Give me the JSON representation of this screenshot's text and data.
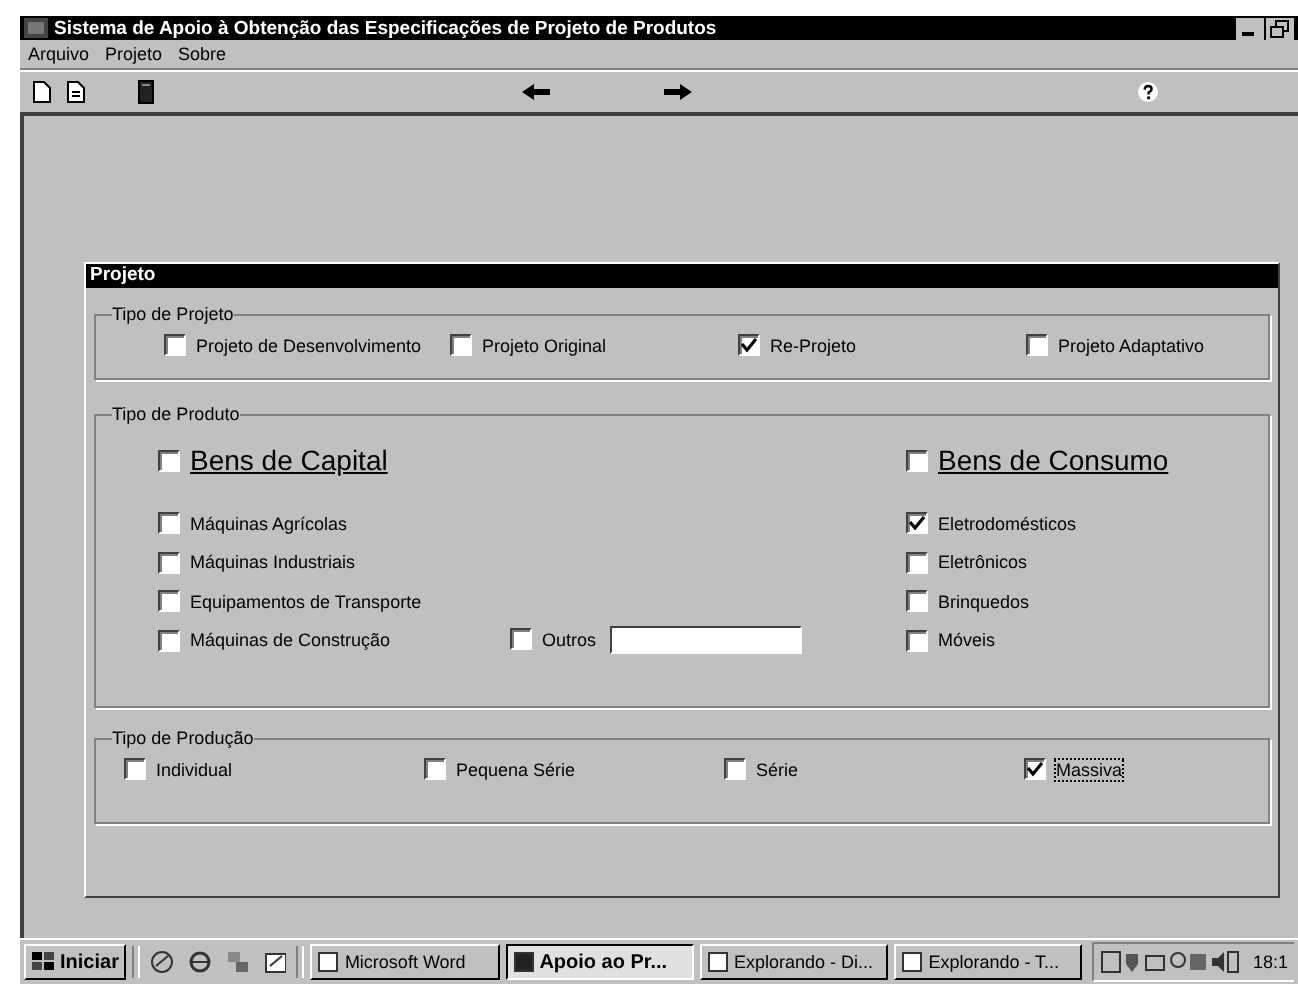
{
  "window": {
    "title": "Sistema de Apoio à Obtenção das Especificações de Projeto de Produtos"
  },
  "menu": [
    {
      "label": "Arquivo"
    },
    {
      "label": "Projeto"
    },
    {
      "label": "Sobre"
    }
  ],
  "dialog": {
    "title": "Projeto",
    "tipo_projeto": {
      "legend": "Tipo de Projeto",
      "options": [
        {
          "label": "Projeto de Desenvolvimento",
          "checked": false
        },
        {
          "label": "Projeto Original",
          "checked": false
        },
        {
          "label": "Re-Projeto",
          "checked": true
        },
        {
          "label": "Projeto Adaptativo",
          "checked": false
        }
      ]
    },
    "tipo_produto": {
      "legend": "Tipo de Produto",
      "capital": {
        "label": "Bens de Capital",
        "checked": false,
        "items": [
          {
            "label": "Máquinas Agrícolas",
            "checked": false
          },
          {
            "label": "Máquinas Industriais",
            "checked": false
          },
          {
            "label": "Equipamentos de Transporte",
            "checked": false
          },
          {
            "label": "Máquinas de Construção",
            "checked": false
          }
        ]
      },
      "outros": {
        "label": "Outros",
        "checked": false
      },
      "consumo": {
        "label": "Bens de Consumo",
        "checked": false,
        "items": [
          {
            "label": "Eletrodomésticos",
            "checked": true
          },
          {
            "label": "Eletrônicos",
            "checked": false
          },
          {
            "label": "Brinquedos",
            "checked": false
          },
          {
            "label": "Móveis",
            "checked": false
          }
        ]
      }
    },
    "tipo_producao": {
      "legend": "Tipo de Produção",
      "options": [
        {
          "label": "Individual",
          "checked": false,
          "focused": false
        },
        {
          "label": "Pequena Série",
          "checked": false,
          "focused": false
        },
        {
          "label": "Série",
          "checked": false,
          "focused": false
        },
        {
          "label": "Massiva",
          "checked": true,
          "focused": true
        }
      ]
    }
  },
  "taskbar": {
    "start": "Iniciar",
    "tasks": [
      {
        "label": "Microsoft Word",
        "selected": false
      },
      {
        "label": "Apoio ao Pr...",
        "selected": true
      },
      {
        "label": "Explorando - Di...",
        "selected": false
      },
      {
        "label": "Explorando - T...",
        "selected": false
      }
    ],
    "clock": "18:1"
  }
}
